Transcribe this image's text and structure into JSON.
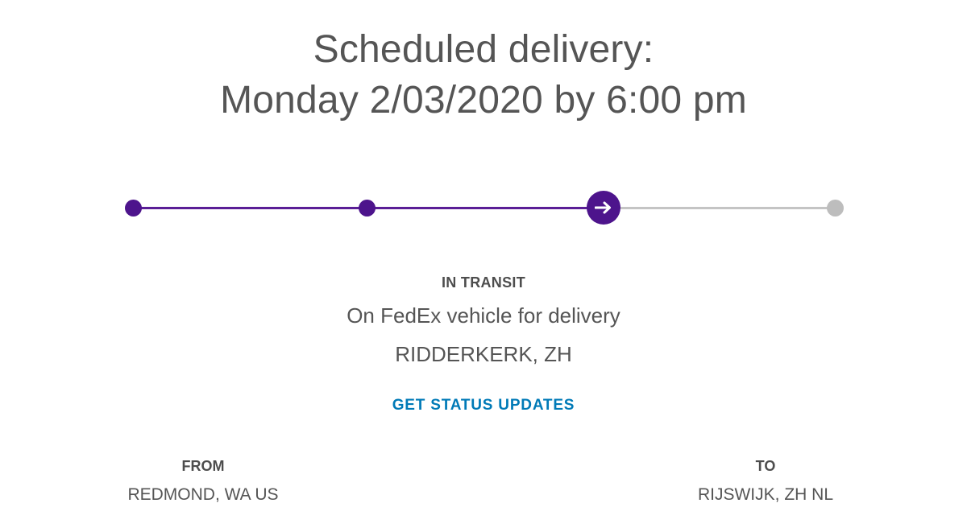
{
  "delivery": {
    "heading_line1": "Scheduled delivery:",
    "heading_line2": "Monday 2/03/2020 by 6:00 pm"
  },
  "progress": {
    "steps_total": 4,
    "current_step": 3,
    "current_icon": "arrow-right-icon",
    "done_color": "#4d148c",
    "pending_color": "#bdbdbd"
  },
  "status": {
    "label": "IN TRANSIT",
    "description": "On FedEx vehicle for delivery",
    "location": "RIDDERKERK, ZH"
  },
  "actions": {
    "updates_link": "GET STATUS UPDATES",
    "link_color": "#007ab7"
  },
  "route": {
    "from_label": "FROM",
    "from_value": "REDMOND, WA US",
    "to_label": "TO",
    "to_value": "RIJSWIJK, ZH NL"
  }
}
